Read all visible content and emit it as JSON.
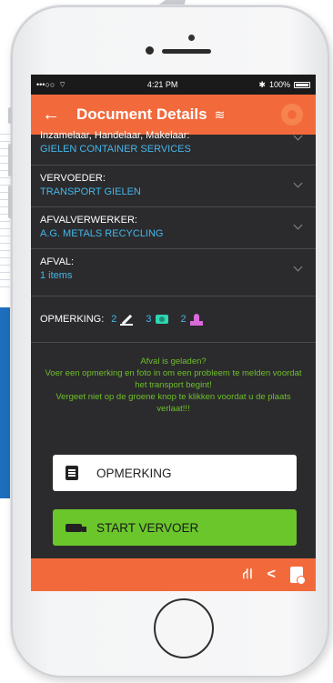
{
  "status": {
    "carrier": "•••○○",
    "time": "4:21 PM",
    "bluetooth": "✱",
    "battery": "100%"
  },
  "appbar": {
    "back_icon": "arrow-left-icon",
    "title": "Document Details",
    "wifi_icon": "wifi-off-icon",
    "settings_icon": "gear-icon"
  },
  "rows": [
    {
      "label": "Inzamelaar, Handelaar, Makelaar:",
      "value": "GIELEN CONTAINER SERVICES"
    },
    {
      "label": "VERVOEDER:",
      "value": "TRANSPORT GIELEN"
    },
    {
      "label": "AFVALVERWERKER:",
      "value": "A.G. METALS RECYCLING"
    },
    {
      "label": "AFVAL:",
      "value": "1 items"
    }
  ],
  "opmerking": {
    "label": "OPMERKING:",
    "notes_count": "2",
    "photos_count": "3",
    "stamps_count": "2"
  },
  "notice": [
    "Afval is geladen?",
    "Voer een opmerking en foto in om een probleem te melden voordat het transport begint!",
    "Vergeet niet op de groene knop te klikken voordat u de plaats verlaat!!!"
  ],
  "buttons": {
    "opmerking": "OPMERKING",
    "start": "START VERVOER"
  },
  "colors": {
    "accent": "#f26a3c",
    "link": "#45b6ea",
    "success": "#6ac62b",
    "notice": "#6fbf2a",
    "background": "#2b2b2d"
  }
}
